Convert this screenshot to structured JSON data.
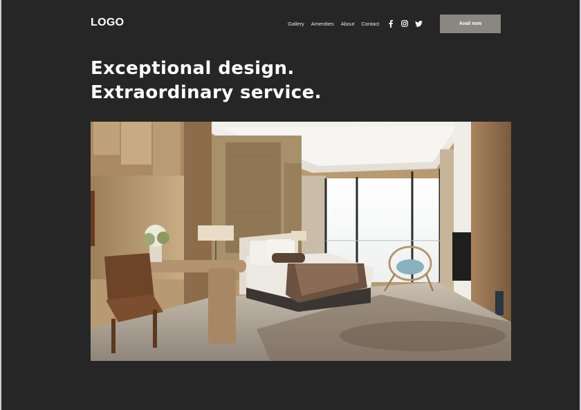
{
  "header": {
    "logo": "LOGO",
    "nav": [
      "Gallery",
      "Amenities",
      "About",
      "Contact"
    ],
    "social_icons": [
      "facebook-icon",
      "instagram-icon",
      "twitter-icon"
    ],
    "cta_label": "Avail now"
  },
  "hero": {
    "headline_line1": "Exceptional design.",
    "headline_line2": "Extraordinary service.",
    "image": "hotel-bedroom-photo"
  },
  "colors": {
    "background": "#262626",
    "cta": "#8a8783",
    "text": "#ffffff"
  }
}
